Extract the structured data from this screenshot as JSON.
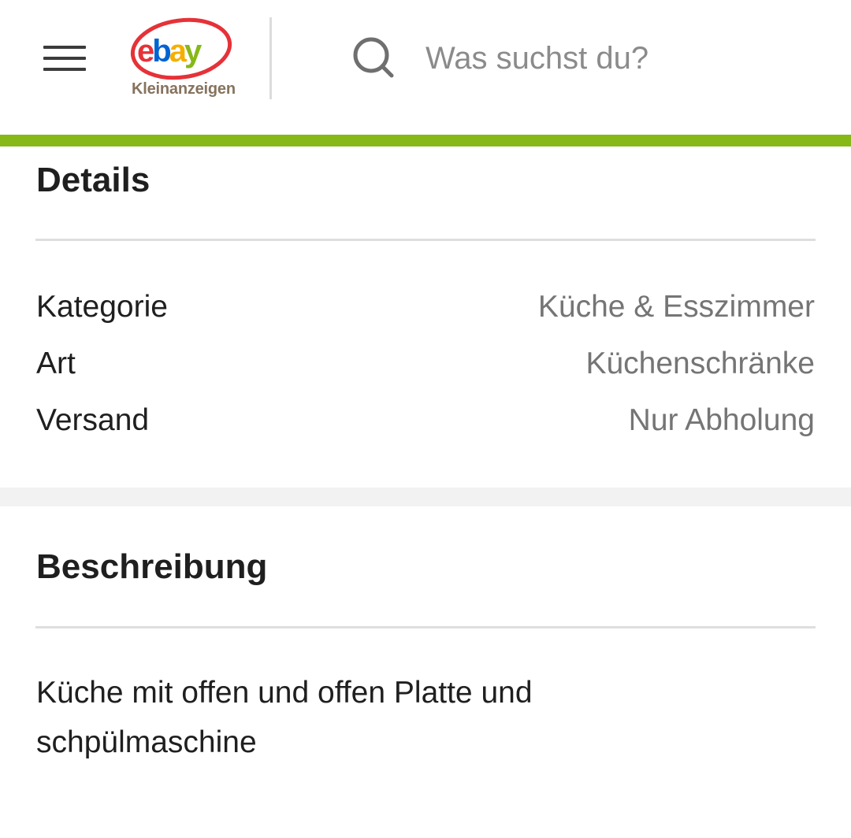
{
  "header": {
    "logo_brand": "ebay",
    "logo_subtitle": "Kleinanzeigen",
    "search_placeholder": "Was suchst du?",
    "menu_icon": "hamburger-menu-icon",
    "search_icon": "search-icon"
  },
  "colors": {
    "accent_green": "#86b817",
    "value_gray": "#757575"
  },
  "details": {
    "title": "Details",
    "rows": [
      {
        "label": "Kategorie",
        "value": "Küche & Esszimmer"
      },
      {
        "label": "Art",
        "value": "Küchenschränke"
      },
      {
        "label": "Versand",
        "value": "Nur Abholung"
      }
    ]
  },
  "description": {
    "title": "Beschreibung",
    "text": "Küche mit offen und offen Platte und\nschpülmaschine"
  }
}
